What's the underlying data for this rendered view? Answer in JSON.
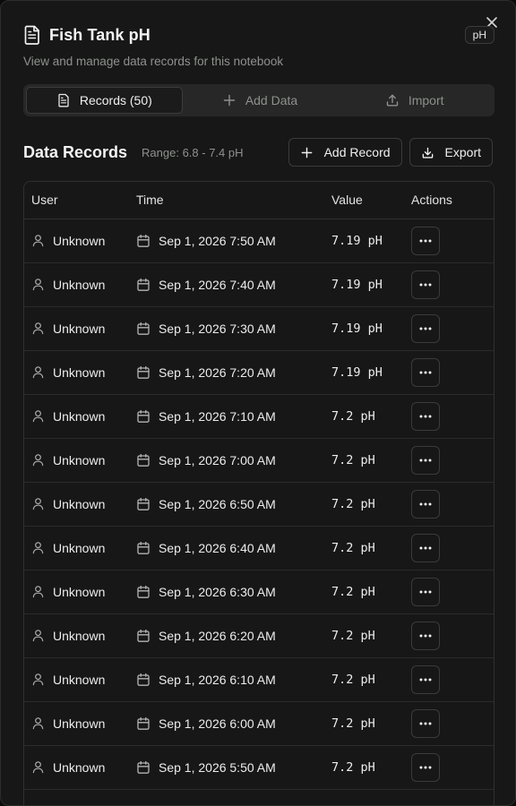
{
  "dialog": {
    "title": "Fish Tank pH",
    "unit_badge": "pH",
    "subtitle": "View and manage data records for this notebook",
    "close_label": "×"
  },
  "tabs": [
    {
      "label": "Records (50)",
      "icon": "document-icon",
      "active": true
    },
    {
      "label": "Add Data",
      "icon": "plus-icon",
      "active": false
    },
    {
      "label": "Import",
      "icon": "upload-icon",
      "active": false
    }
  ],
  "section": {
    "title": "Data Records",
    "range": "Range: 6.8 - 7.4 pH",
    "add_record_label": "Add Record",
    "export_label": "Export"
  },
  "table": {
    "headers": {
      "user": "User",
      "time": "Time",
      "value": "Value",
      "actions": "Actions"
    },
    "rows": [
      {
        "user": "Unknown",
        "time": "Sep 1, 2026 7:50 AM",
        "value": "7.19 pH"
      },
      {
        "user": "Unknown",
        "time": "Sep 1, 2026 7:40 AM",
        "value": "7.19 pH"
      },
      {
        "user": "Unknown",
        "time": "Sep 1, 2026 7:30 AM",
        "value": "7.19 pH"
      },
      {
        "user": "Unknown",
        "time": "Sep 1, 2026 7:20 AM",
        "value": "7.19 pH"
      },
      {
        "user": "Unknown",
        "time": "Sep 1, 2026 7:10 AM",
        "value": "7.2 pH"
      },
      {
        "user": "Unknown",
        "time": "Sep 1, 2026 7:00 AM",
        "value": "7.2 pH"
      },
      {
        "user": "Unknown",
        "time": "Sep 1, 2026 6:50 AM",
        "value": "7.2 pH"
      },
      {
        "user": "Unknown",
        "time": "Sep 1, 2026 6:40 AM",
        "value": "7.2 pH"
      },
      {
        "user": "Unknown",
        "time": "Sep 1, 2026 6:30 AM",
        "value": "7.2 pH"
      },
      {
        "user": "Unknown",
        "time": "Sep 1, 2026 6:20 AM",
        "value": "7.2 pH"
      },
      {
        "user": "Unknown",
        "time": "Sep 1, 2026 6:10 AM",
        "value": "7.2 pH"
      },
      {
        "user": "Unknown",
        "time": "Sep 1, 2026 6:00 AM",
        "value": "7.2 pH"
      },
      {
        "user": "Unknown",
        "time": "Sep 1, 2026 5:50 AM",
        "value": "7.2 pH"
      }
    ]
  },
  "colors": {
    "background": "#161716",
    "border": "#3a3b3a",
    "text": "#ededed",
    "muted": "#8f918f"
  }
}
